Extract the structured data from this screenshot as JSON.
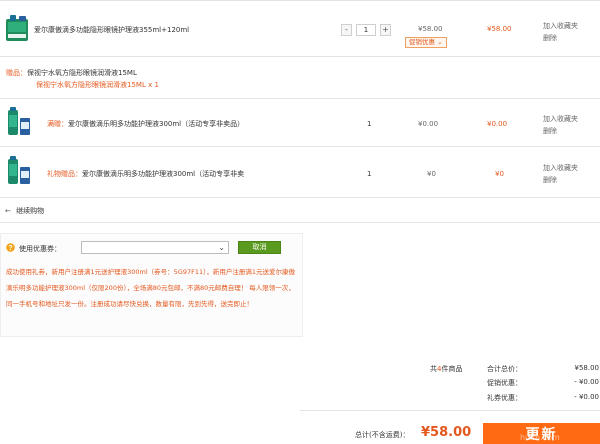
{
  "items": [
    {
      "name": "爱尔康傲滴多功能隐形眼镜护理液355ml+120ml",
      "quantity": "1",
      "minus": "-",
      "plus": "+",
      "unit_price": "¥58.00",
      "subtotal": "¥58.00",
      "promo_label": "促销优惠",
      "promo_arrow": "⌄",
      "action_favorite": "加入收藏夹",
      "action_delete": "删除"
    },
    {
      "tag": "满赠：",
      "name": "爱尔康傲滴乐明多功能护理液300ml（活动专享非卖品）",
      "quantity": "1",
      "unit_price": "¥0.00",
      "subtotal": "¥0.00",
      "action_favorite": "加入收藏夹",
      "action_delete": "删除"
    },
    {
      "tag": "礼物赠品：",
      "name": "爱尔康傲滴乐明多功能护理液300ml（活动专享非卖",
      "quantity": "1",
      "unit_price": "¥0",
      "subtotal": "¥0",
      "action_favorite": "加入收藏夹",
      "action_delete": "删除"
    }
  ],
  "gift_section": {
    "label": "赠品：",
    "title": "保视宁水氧方隐形眼镜润滑液15ML",
    "link": "保视宁水氧方隐形眼镜润滑液15ML x 1"
  },
  "continue_shopping": {
    "arrow": "←",
    "label": "继续购物"
  },
  "coupon": {
    "help_icon": "?",
    "label": "使用优惠券：",
    "select_value": "",
    "select_arrow": "⌄",
    "cancel_label": "取消",
    "note": "成功使用礼券，新用户注册满1元送护理液300ml（券号：5G97F11），新用户注册满1元送爱尔康傲滴乐明多功能护理液300ml（仅限200份），全场满80元包邮，不满80元邮费自理！ 每人限领一次，同一手机号和地址只发一份。注册成功请尽快兑换，数量有限，先到先得，送完即止！"
  },
  "summary": {
    "count_prefix": "共",
    "count": "4",
    "count_suffix": "件商品",
    "total_label": "合计总价：",
    "total_value": "¥58.00",
    "promo_label": "促销优惠：",
    "promo_value": "- ¥0.00",
    "coupon_label": "礼券优惠：",
    "coupon_value": "- ¥0.00",
    "grand_label": "总计(不含运费)：",
    "grand_value": "¥58.00",
    "checkout_label": "更新",
    "watermark": "huim.com"
  },
  "colors": {
    "accent": "#e4581e",
    "checkout": "#ff6a12",
    "cancel_button": "#5a9a1e"
  }
}
